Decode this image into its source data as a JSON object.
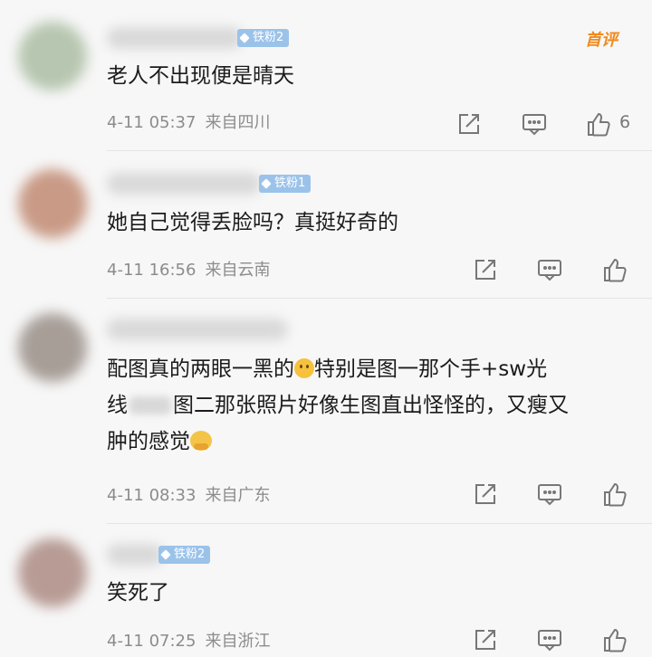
{
  "comments": [
    {
      "name": "",
      "fan_badge": "铁粉2",
      "first_badge": "首评",
      "text": "老人不出现便是晴天",
      "date": "4-11 05:37",
      "source": "来自四川",
      "like_count": "6",
      "avatar_color": "#b7c6b0"
    },
    {
      "name": "",
      "fan_badge": "铁粉1",
      "text": "她自己觉得丢脸吗？真挺好奇的",
      "date": "4-11 16:56",
      "source": "来自云南",
      "avatar_color": "#c99a86"
    },
    {
      "name": "",
      "text_parts": {
        "a": "配图真的两眼一黑的",
        "b": "特别是图一那个手+sw光",
        "c": "线",
        "d": "图二那张照片好像生图直出怪怪的，又瘦又",
        "e": "肿的感觉"
      },
      "emojis": [
        "smile-emoji",
        "hug-emoji"
      ],
      "date": "4-11 08:33",
      "source": "来自广东",
      "avatar_color": "#a79e98"
    },
    {
      "name": "",
      "fan_badge": "铁粉2",
      "text": "笑死了",
      "date": "4-11 07:25",
      "source": "来自浙江",
      "avatar_color": "#b79b94"
    }
  ],
  "icons": [
    "share-icon",
    "comment-icon",
    "like-icon"
  ],
  "colors": {
    "fan_badge": "#9bc3ea",
    "first_badge": "#f08a1c",
    "meta_text": "#8c8c8c",
    "icon_stroke": "#777777"
  }
}
